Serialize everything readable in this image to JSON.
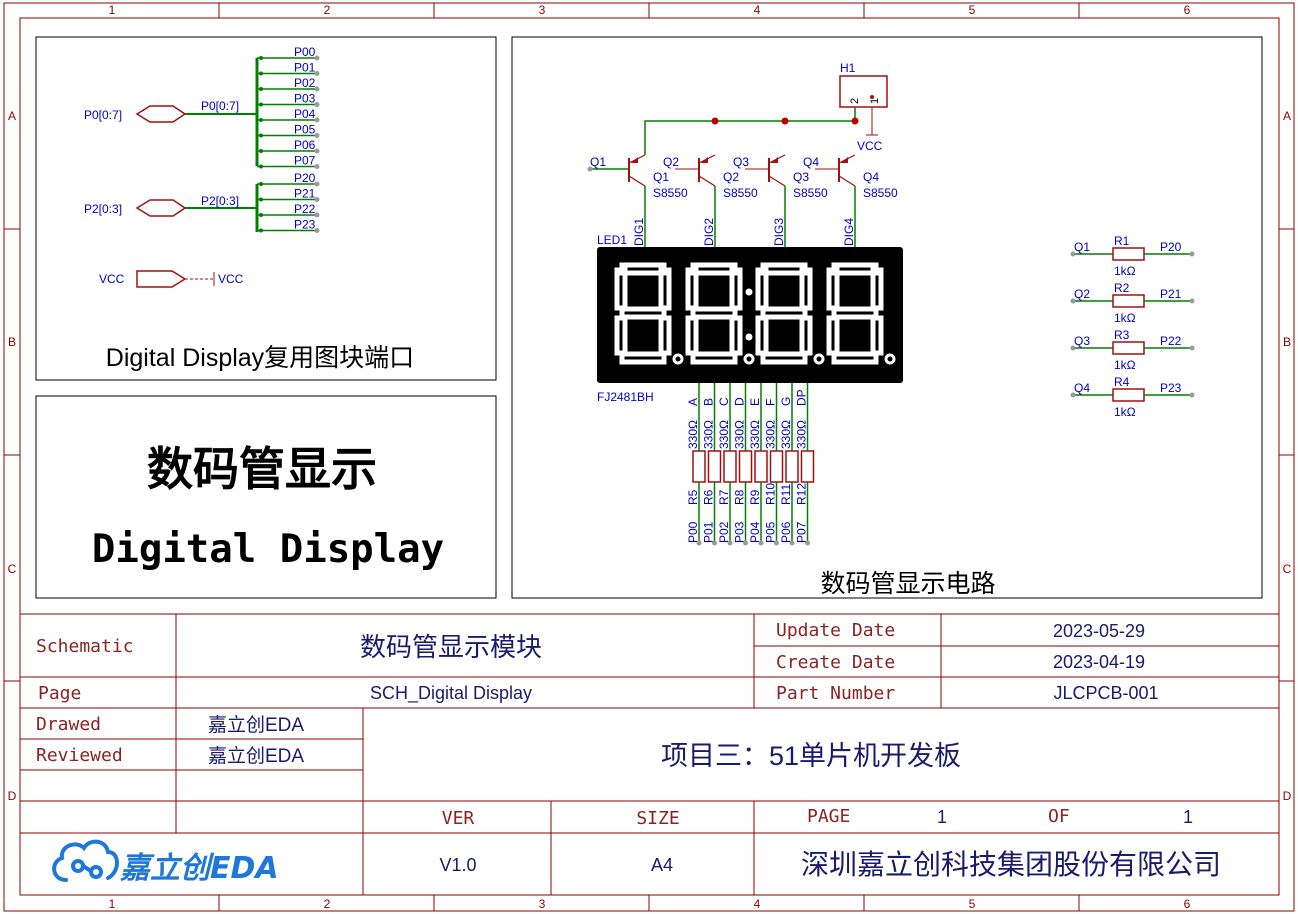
{
  "frame": {
    "col_labels": [
      "1",
      "2",
      "3",
      "4",
      "5",
      "6"
    ],
    "row_labels": [
      "A",
      "B",
      "C",
      "D"
    ]
  },
  "reuse_block": {
    "title": "Digital Display复用图块端口",
    "ports": [
      {
        "label": "P0[0:7]",
        "bus": "P0[0:7]",
        "nets": [
          "P00",
          "P01",
          "P02",
          "P03",
          "P04",
          "P05",
          "P06",
          "P07"
        ]
      },
      {
        "label": "P2[0:3]",
        "bus": "P2[0:3]",
        "nets": [
          "P20",
          "P21",
          "P22",
          "P23"
        ]
      }
    ],
    "vcc_port": "VCC",
    "vcc_net": "VCC"
  },
  "title_block": {
    "cn": "数码管显示",
    "en": "Digital Display"
  },
  "circuit": {
    "title": "数码管显示电路",
    "header": {
      "ref": "H1",
      "pin2": "2",
      "pin1": "1",
      "net": "VCC"
    },
    "transistors": [
      {
        "base_net": "Q1",
        "ref": "Q1",
        "part": "S8550",
        "digit": "DIG1"
      },
      {
        "base_net": "Q2",
        "ref": "Q2",
        "part": "S8550",
        "digit": "DIG2"
      },
      {
        "base_net": "Q3",
        "ref": "Q3",
        "part": "S8550",
        "digit": "DIG3"
      },
      {
        "base_net": "Q4",
        "ref": "Q4",
        "part": "S8550",
        "digit": "DIG4"
      }
    ],
    "display": {
      "ref": "LED1",
      "part": "FJ2481BH"
    },
    "segment_pins": [
      "A",
      "B",
      "C",
      "D",
      "E",
      "F",
      "G",
      "DP"
    ],
    "segment_resistors": [
      {
        "ref": "R5",
        "value": "330Ω",
        "net": "P00"
      },
      {
        "ref": "R6",
        "value": "330Ω",
        "net": "P01"
      },
      {
        "ref": "R7",
        "value": "330Ω",
        "net": "P02"
      },
      {
        "ref": "R8",
        "value": "330Ω",
        "net": "P03"
      },
      {
        "ref": "R9",
        "value": "330Ω",
        "net": "P04"
      },
      {
        "ref": "R10",
        "value": "330Ω",
        "net": "P05"
      },
      {
        "ref": "R11",
        "value": "330Ω",
        "net": "P06"
      },
      {
        "ref": "R12",
        "value": "330Ω",
        "net": "P07"
      }
    ],
    "base_resistors": [
      {
        "left": "Q1",
        "ref": "R1",
        "value": "1kΩ",
        "right": "P20"
      },
      {
        "left": "Q2",
        "ref": "R2",
        "value": "1kΩ",
        "right": "P21"
      },
      {
        "left": "Q3",
        "ref": "R3",
        "value": "1kΩ",
        "right": "P22"
      },
      {
        "left": "Q4",
        "ref": "R4",
        "value": "1kΩ",
        "right": "P23"
      }
    ]
  },
  "info": {
    "schematic_label": "Schematic",
    "schematic_value": "数码管显示模块",
    "update_label": "Update Date",
    "update_value": "2023-05-29",
    "create_label": "Create Date",
    "create_value": "2023-04-19",
    "page_label": "Page",
    "page_value": "SCH_Digital Display",
    "part_label": "Part Number",
    "part_value": "JLCPCB-001",
    "drawed_label": "Drawed",
    "drawed_value": "嘉立创EDA",
    "reviewed_label": "Reviewed",
    "reviewed_value": "嘉立创EDA",
    "project": "项目三：51单片机开发板",
    "ver_label": "VER",
    "ver_value": "V1.0",
    "size_label": "SIZE",
    "size_value": "A4",
    "page_no_label": "PAGE",
    "page_no_value": "1",
    "of_label": "OF",
    "of_value": "1",
    "logo_text": "嘉立创EDA",
    "company": "深圳嘉立创科技集团股份有限公司"
  },
  "colors": {
    "frame": "#8b0000",
    "wire": "#008000",
    "component": "#a01010",
    "net_label": "#0000c8",
    "display_body": "#000000",
    "logo": "#1e78d7"
  }
}
